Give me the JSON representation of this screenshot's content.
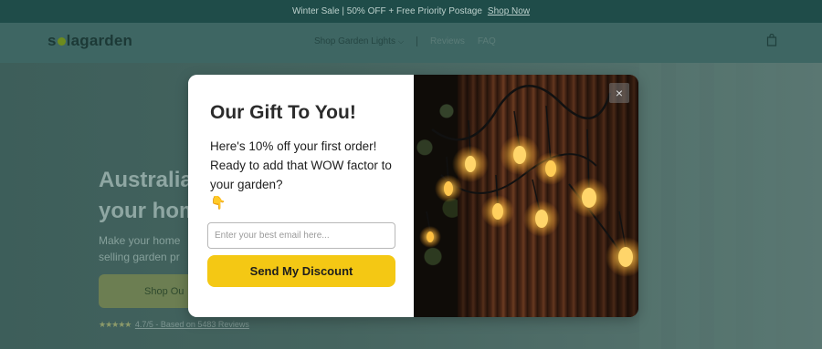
{
  "announcement": {
    "text": "Winter Sale | 50% OFF + Free Priority Postage",
    "link": "Shop Now"
  },
  "header": {
    "logo_pre": "s",
    "logo_post": "lagarden",
    "nav": [
      {
        "label": "Shop Garden Lights",
        "has_dropdown": true
      },
      {
        "label": "Reviews"
      },
      {
        "label": "FAQ"
      }
    ],
    "cart_icon": "shopping-bag-icon"
  },
  "hero": {
    "title_line1": "Australia",
    "title_line2": "your hom",
    "subtitle_line1": "Make your home",
    "subtitle_line2": "selling garden pr",
    "button": "Shop Ou",
    "rating_text": "4.7/5 - Based on 5483 Reviews",
    "stars": "★★★★★"
  },
  "popup": {
    "title": "Our Gift To You!",
    "text": "Here's 10% off your first order! Ready to add that WOW factor to your garden?",
    "emoji": "👇",
    "email_placeholder": "Enter your best email here...",
    "email_value": "",
    "button": "Send My Discount",
    "close": "×",
    "colors": {
      "button": "#f4c814",
      "title": "#2b2b2b"
    }
  }
}
